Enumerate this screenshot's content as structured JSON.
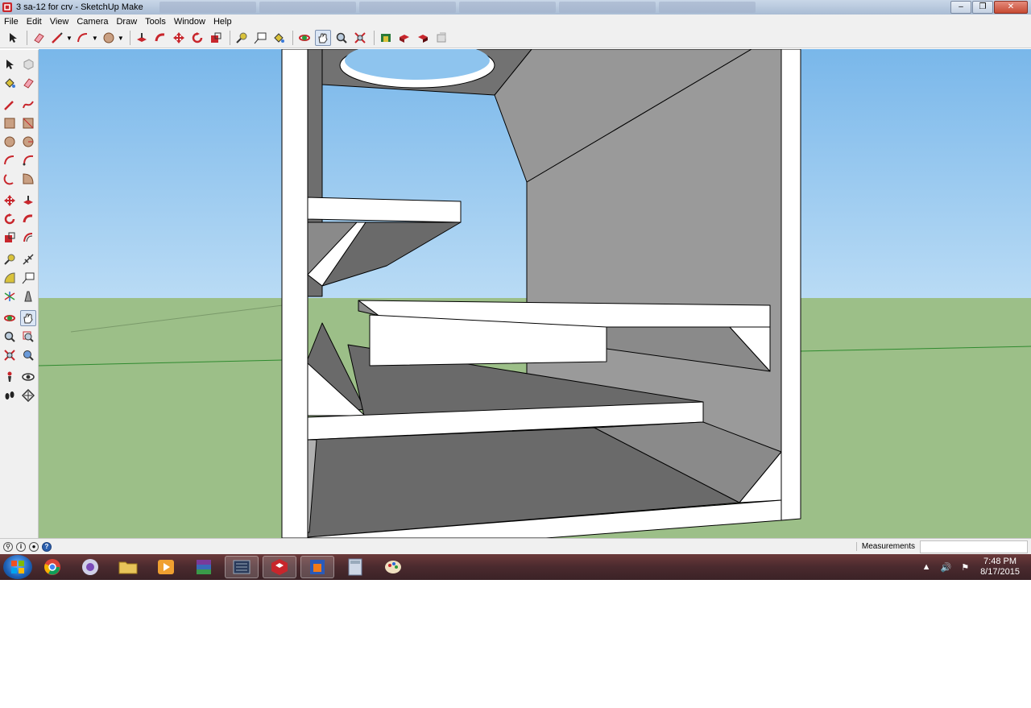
{
  "window": {
    "title": "3 sa-12 for crv - SketchUp Make",
    "controls": {
      "minimize": "–",
      "maximize": "❐",
      "close": "✕"
    }
  },
  "menu": [
    "File",
    "Edit",
    "View",
    "Camera",
    "Draw",
    "Tools",
    "Window",
    "Help"
  ],
  "status": {
    "measurements_label": "Measurements",
    "measurements_value": ""
  },
  "taskbar": {
    "apps": [
      "chrome-icon",
      "media-center-icon",
      "folder-icon",
      "media-player-icon",
      "winrar-icon",
      "keyboard-app-icon",
      "sketchup-icon",
      "layout-icon",
      "calculator-icon",
      "paint-icon"
    ],
    "time": "7:48 PM",
    "date": "8/17/2015"
  },
  "colors": {
    "sky": "#8ec4ee",
    "ground": "#9cbf88",
    "face_light": "#ffffff",
    "face_mid": "#9a9a9a",
    "face_dark": "#6a6a6a",
    "accent_red": "#c8262c"
  }
}
